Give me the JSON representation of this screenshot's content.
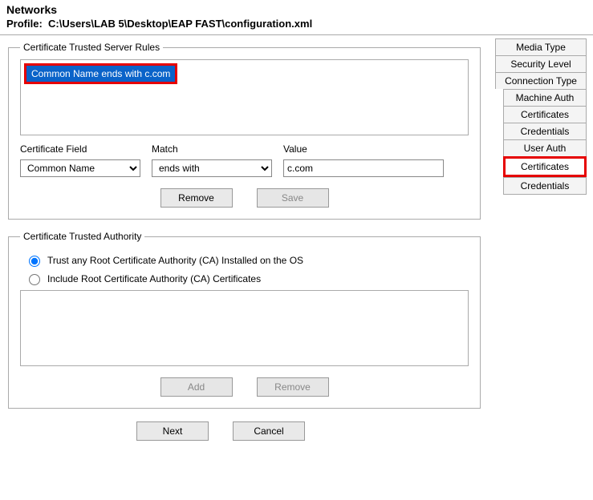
{
  "header": {
    "title": "Networks",
    "profile_label": "Profile:",
    "profile_path": "C:\\Users\\LAB 5\\Desktop\\EAP FAST\\configuration.xml"
  },
  "tabs": [
    {
      "label": "Media Type",
      "indent": false
    },
    {
      "label": "Security Level",
      "indent": false
    },
    {
      "label": "Connection Type",
      "indent": false
    },
    {
      "label": "Machine Auth",
      "indent": true
    },
    {
      "label": "Certificates",
      "indent": true
    },
    {
      "label": "Credentials",
      "indent": true
    },
    {
      "label": "User Auth",
      "indent": true
    },
    {
      "label": "Certificates",
      "indent": true,
      "highlighted": true
    },
    {
      "label": "Credentials",
      "indent": true
    }
  ],
  "rules": {
    "legend": "Certificate Trusted Server Rules",
    "items": [
      {
        "text": "Common Name ends with c.com",
        "highlighted": true
      }
    ],
    "field_label": "Certificate Field",
    "match_label": "Match",
    "value_label": "Value",
    "field_value": "Common Name",
    "match_value": "ends with",
    "value_value": "c.com",
    "remove_label": "Remove",
    "save_label": "Save"
  },
  "authority": {
    "legend": "Certificate Trusted Authority",
    "option1": "Trust any Root Certificate Authority (CA) Installed on the OS",
    "option2": "Include Root Certificate Authority (CA) Certificates",
    "add_label": "Add",
    "remove_label": "Remove"
  },
  "footer": {
    "next": "Next",
    "cancel": "Cancel"
  }
}
